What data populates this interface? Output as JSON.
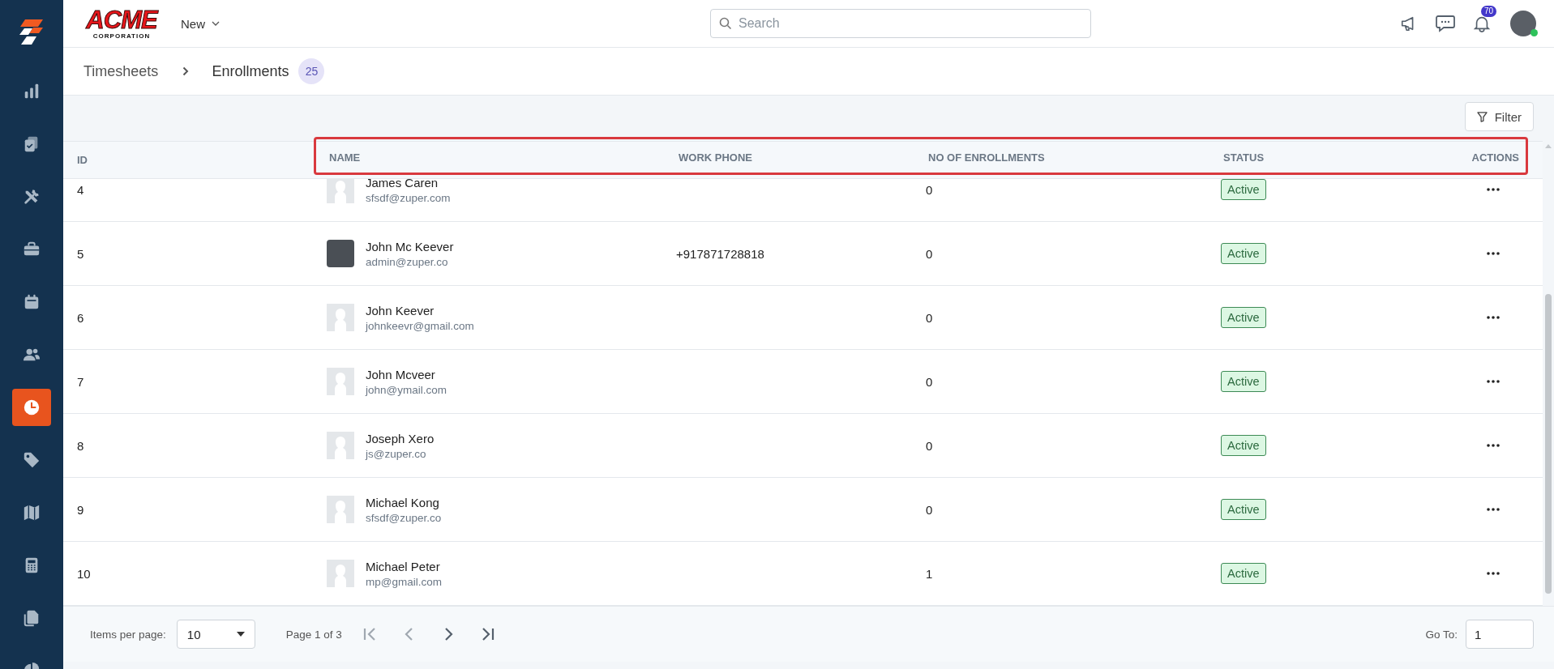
{
  "sidebar": {
    "items": [
      {
        "selected": false
      },
      {
        "selected": false
      },
      {
        "selected": false
      },
      {
        "selected": false
      },
      {
        "selected": false
      },
      {
        "selected": false
      },
      {
        "selected": true
      },
      {
        "selected": false
      },
      {
        "selected": false
      },
      {
        "selected": false
      },
      {
        "selected": false
      },
      {
        "selected": false
      }
    ]
  },
  "topbar": {
    "logo": {
      "title": "ACME",
      "subtitle": "CORPORATION"
    },
    "new_menu": "New",
    "search": {
      "placeholder": "Search"
    },
    "notifications": "70",
    "user": {
      "online": true
    }
  },
  "breadcrumb": {
    "parent": "Timesheets",
    "current": "Enrollments",
    "count": "25"
  },
  "toolbar": {
    "filter": "Filter"
  },
  "table": {
    "header_highlighted": true,
    "columns": [
      "ID",
      "NAME",
      "WORK PHONE",
      "NO OF ENROLLMENTS",
      "STATUS",
      "ACTIONS"
    ],
    "rows": [
      {
        "id": "4",
        "name": "James Caren",
        "email": "sfsdf@zuper.com",
        "avatar": {
          "kind": "placeholder"
        },
        "enrollments": "0",
        "status": "Active"
      },
      {
        "id": "5",
        "name": "John Mc Keever",
        "email": "admin@zuper.co",
        "avatar": {
          "kind": "photo"
        },
        "work_phone": "+917871728818",
        "enrollments": "0",
        "status": "Active"
      },
      {
        "id": "6",
        "name": "John Keever",
        "email": "johnkeevr@gmail.com",
        "avatar": {
          "kind": "placeholder"
        },
        "enrollments": "0",
        "status": "Active"
      },
      {
        "id": "7",
        "name": "John Mcveer",
        "email": "john@ymail.com",
        "avatar": {
          "kind": "placeholder"
        },
        "enrollments": "0",
        "status": "Active"
      },
      {
        "id": "8",
        "name": "Joseph Xero",
        "email": "js@zuper.co",
        "avatar": {
          "kind": "placeholder"
        },
        "enrollments": "0",
        "status": "Active"
      },
      {
        "id": "9",
        "name": "Michael Kong",
        "email": "sfsdf@zuper.co",
        "avatar": {
          "kind": "placeholder"
        },
        "enrollments": "0",
        "status": "Active"
      },
      {
        "id": "10",
        "name": "Michael Peter",
        "email": "mp@gmail.com",
        "avatar": {
          "kind": "placeholder"
        },
        "enrollments": "1",
        "status": "Active"
      }
    ]
  },
  "pagination": {
    "items_per_page_label": "Items per page:",
    "items_per_page": "10",
    "page_info": "Page 1 of 3",
    "nav": [
      {
        "kind": "first",
        "disabled": true
      },
      {
        "kind": "prev",
        "disabled": true
      },
      {
        "kind": "next",
        "disabled": false
      },
      {
        "kind": "last",
        "disabled": false
      }
    ],
    "goto_label": "Go To:",
    "goto_value": "1"
  }
}
